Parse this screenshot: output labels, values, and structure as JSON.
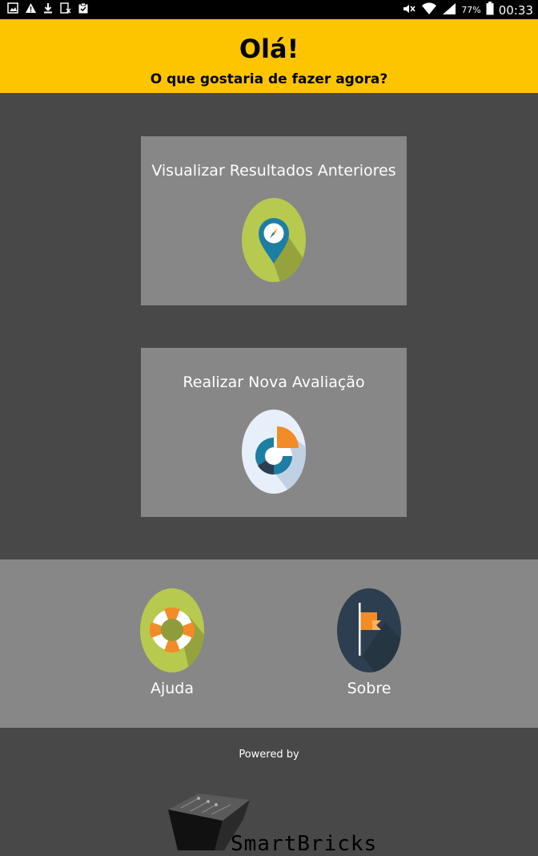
{
  "status_bar": {
    "icons_left": [
      "gallery-icon",
      "warning-icon",
      "download-icon",
      "screenshot-icon",
      "clipboard-check-icon"
    ],
    "icons_right": [
      "mute-icon",
      "wifi-icon",
      "signal-icon",
      "battery-icon"
    ],
    "battery": "77%",
    "time": "00:33"
  },
  "header": {
    "title": "Olá!",
    "subtitle": "O que gostaria de fazer agora?",
    "color": "#fdc500"
  },
  "cards": [
    {
      "label": "Visualizar Resultados Anteriores",
      "icon": "compass-pin-icon"
    },
    {
      "label": "Realizar Nova Avaliação",
      "icon": "donut-chart-icon"
    }
  ],
  "nav": {
    "help_label": "Ajuda",
    "help_icon": "lifebuoy-icon",
    "about_label": "Sobre",
    "about_icon": "flag-icon"
  },
  "footer": {
    "powered_by": "Powered by",
    "brand": "SmartBricks"
  }
}
